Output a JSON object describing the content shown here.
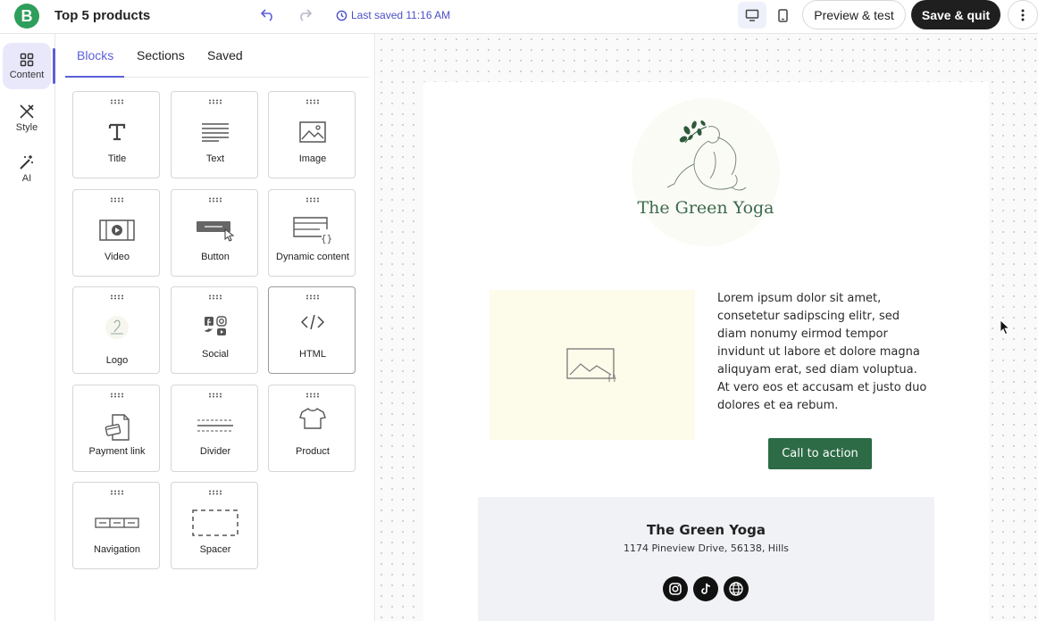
{
  "app": {
    "logo_letter": "B",
    "title": "Top 5 products"
  },
  "toolbar": {
    "last_saved": "Last saved 11:16 AM",
    "preview_label": "Preview & test",
    "save_label": "Save & quit"
  },
  "rail": {
    "items": [
      {
        "label": "Content",
        "icon": "grid-icon"
      },
      {
        "label": "Style",
        "icon": "brush-icon"
      },
      {
        "label": "AI",
        "icon": "magic-wand-icon"
      }
    ]
  },
  "tabs": [
    {
      "label": "Blocks"
    },
    {
      "label": "Sections"
    },
    {
      "label": "Saved"
    }
  ],
  "blocks": [
    {
      "label": "Title",
      "icon": "title-icon"
    },
    {
      "label": "Text",
      "icon": "text-icon"
    },
    {
      "label": "Image",
      "icon": "image-icon"
    },
    {
      "label": "Video",
      "icon": "video-icon"
    },
    {
      "label": "Button",
      "icon": "button-icon"
    },
    {
      "label": "Dynamic content",
      "icon": "dynamic-content-icon"
    },
    {
      "label": "Logo",
      "icon": "logo-icon"
    },
    {
      "label": "Social",
      "icon": "social-icon"
    },
    {
      "label": "HTML",
      "icon": "code-icon"
    },
    {
      "label": "Payment link",
      "icon": "payment-link-icon"
    },
    {
      "label": "Divider",
      "icon": "divider-icon"
    },
    {
      "label": "Product",
      "icon": "tshirt-icon"
    },
    {
      "label": "Navigation",
      "icon": "navigation-icon"
    },
    {
      "label": "Spacer",
      "icon": "spacer-icon"
    }
  ],
  "email": {
    "brand_name": "The Green Yoga",
    "body_text": "Lorem ipsum dolor sit amet, consetetur sadipscing elitr, sed diam nonumy eirmod tempor invidunt ut labore et dolore magna aliquyam erat, sed diam voluptua. At vero eos et accusam et justo duo dolores et ea rebum.",
    "cta_label": "Call to action",
    "footer_title": "The Green Yoga",
    "footer_address": "1174 Pineview Drive, 56138, Hills",
    "social_icons": [
      "instagram-icon",
      "tiktok-icon",
      "globe-icon"
    ]
  },
  "colors": {
    "accent": "#5b5fd8",
    "brand_green": "#2c6b45",
    "saved_text": "#4a4fc4",
    "save_button": "#1f1f1f"
  }
}
